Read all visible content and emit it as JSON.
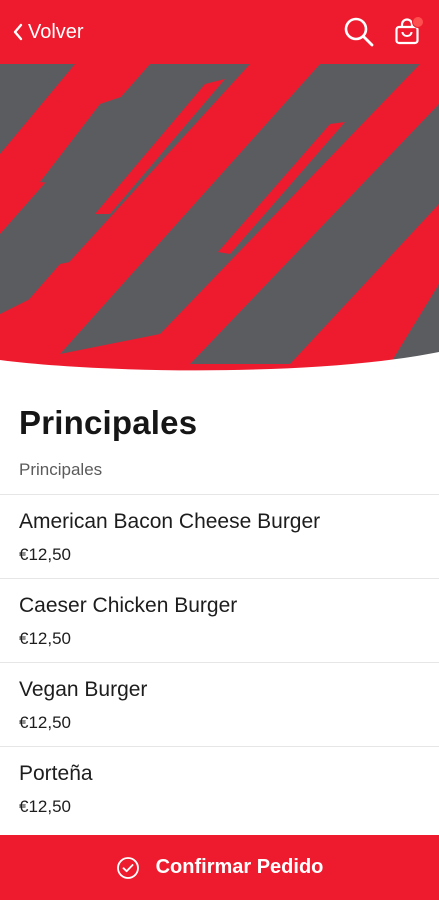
{
  "header": {
    "back_label": "Volver",
    "search_icon": "search-icon",
    "cart_icon": "shopping-bag-icon"
  },
  "hero": {
    "pattern": "diagonal-brush-stripes",
    "colors": {
      "primary": "#ee1b2e",
      "secondary": "#5a5c60"
    }
  },
  "page": {
    "title": "Principales",
    "section_label": "Principales"
  },
  "items": [
    {
      "name": "American Bacon Cheese Burger",
      "price": "€12,50"
    },
    {
      "name": "Caeser Chicken Burger",
      "price": "€12,50"
    },
    {
      "name": "Vegan Burger",
      "price": "€12,50"
    },
    {
      "name": "Porteña",
      "price": "€12,50"
    }
  ],
  "footer": {
    "confirm_label": "Confirmar Pedido",
    "confirm_icon": "check-circle-icon"
  },
  "colors": {
    "accent": "#ee1b2e",
    "notification_dot": "#ff4f4f"
  }
}
